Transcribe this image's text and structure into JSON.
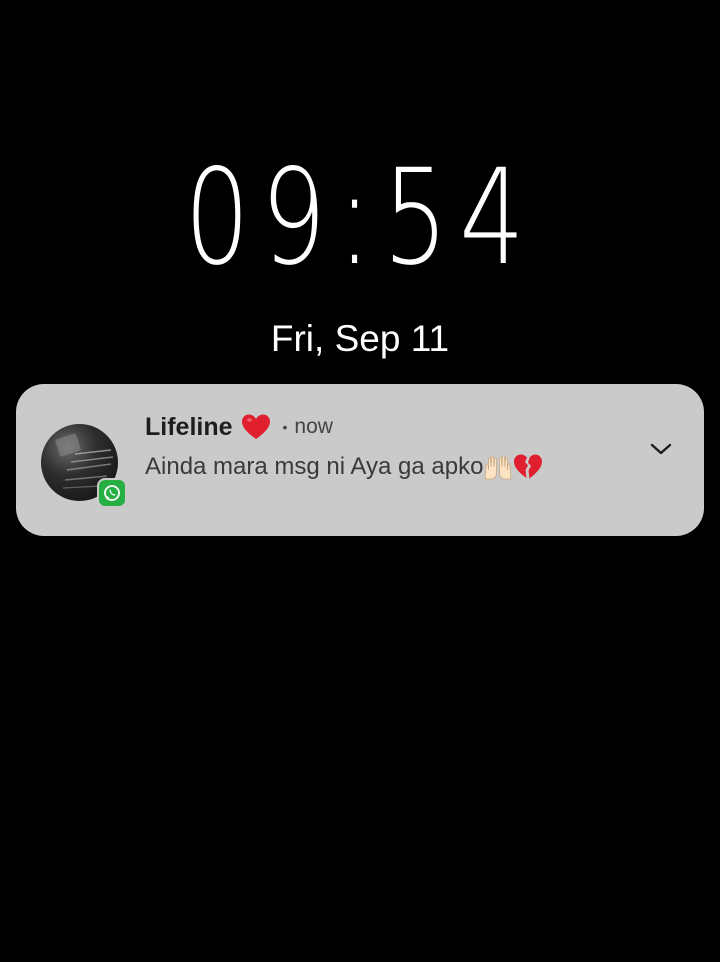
{
  "lockscreen": {
    "time": "09:54",
    "date": "Fri, Sep 11"
  },
  "notification": {
    "sender": "Lifeline",
    "sender_emoji": "red-heart-emoji",
    "separator": "•",
    "time": "now",
    "message": "Ainda mara msg ni Aya ga apko",
    "message_emojis": [
      "raising-hands-emoji",
      "broken-heart-emoji"
    ],
    "app_badge": "whatsapp-icon",
    "expand_icon": "chevron-down-icon"
  },
  "colors": {
    "background": "#000000",
    "card": "#cacaca",
    "whatsapp": "#26b043",
    "heart": "#e0202e"
  }
}
